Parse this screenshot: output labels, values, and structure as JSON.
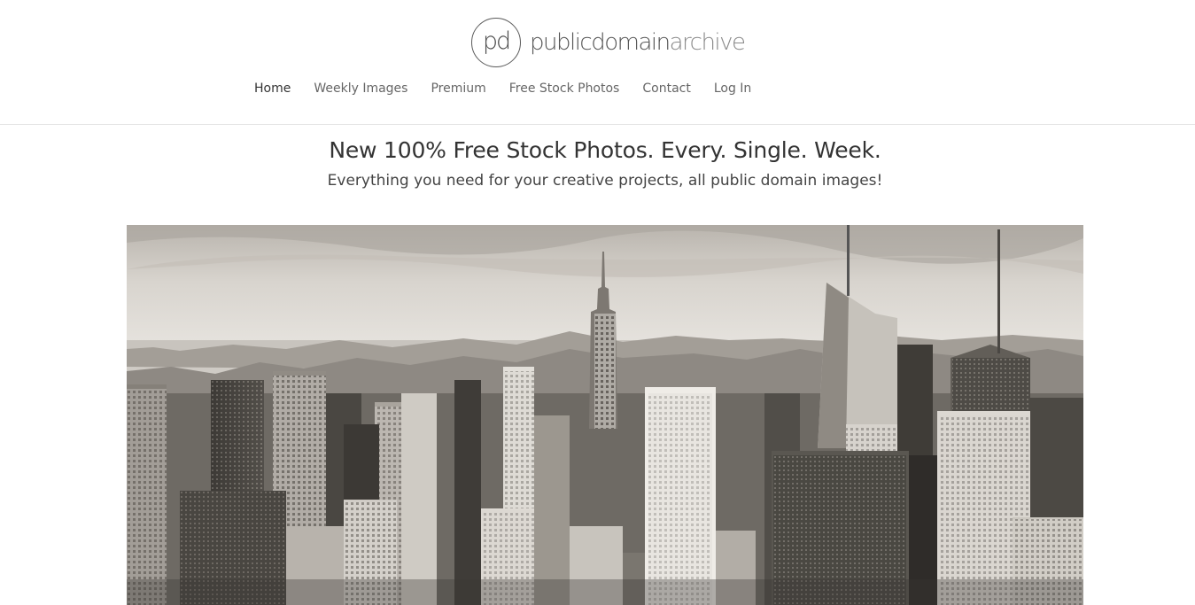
{
  "logo": {
    "mark": "pd",
    "text_main": "publicdomain",
    "text_light": "archive"
  },
  "nav": {
    "items": [
      {
        "label": "Home",
        "active": true
      },
      {
        "label": "Weekly Images",
        "active": false
      },
      {
        "label": "Premium",
        "active": false
      },
      {
        "label": "Free Stock Photos",
        "active": false
      },
      {
        "label": "Contact",
        "active": false
      },
      {
        "label": "Log In",
        "active": false
      }
    ]
  },
  "hero": {
    "title": "New 100% Free Stock Photos. Every. Single. Week.",
    "subtitle": "Everything you need for your creative projects, all public domain images!"
  },
  "featured_image": {
    "icon": "city-skyline-photo"
  }
}
